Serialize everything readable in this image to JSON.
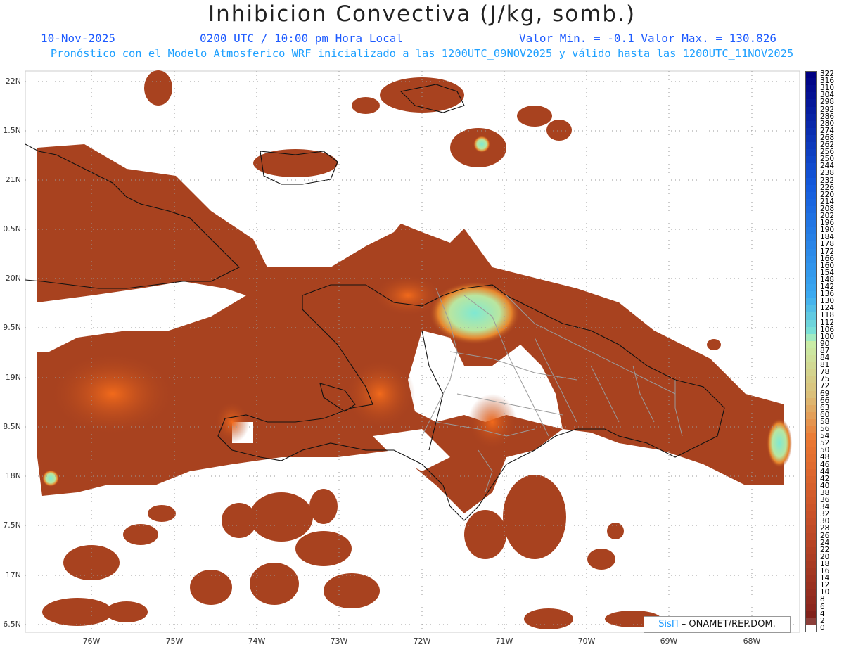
{
  "title": "Inhibicion Convectiva (J/kg, somb.)",
  "date": "10-Nov-2025",
  "time": "0200 UTC / 10:00 pm Hora Local",
  "minmax": "Valor Min. = -0.1  Valor Max. = 130.826",
  "model_line": "Pronóstico con el Modelo Atmosferico WRF inicializado a las 1200UTC_09NOV2025 y válido hasta las  1200UTC_11NOV2025",
  "lat_labels": [
    "22N",
    "1.5N",
    "21N",
    "0.5N",
    "20N",
    "9.5N",
    "19N",
    "8.5N",
    "18N",
    "7.5N",
    "17N",
    "6.5N"
  ],
  "lon_labels": [
    "76W",
    "75W",
    "74W",
    "73W",
    "72W",
    "71W",
    "70W",
    "69W",
    "68W"
  ],
  "legend_values": [
    "322",
    "316",
    "310",
    "304",
    "298",
    "292",
    "286",
    "280",
    "274",
    "268",
    "262",
    "256",
    "250",
    "244",
    "238",
    "232",
    "226",
    "220",
    "214",
    "208",
    "202",
    "196",
    "190",
    "184",
    "178",
    "172",
    "166",
    "160",
    "154",
    "148",
    "142",
    "136",
    "130",
    "124",
    "118",
    "112",
    "106",
    "100",
    "90",
    "87",
    "84",
    "81",
    "78",
    "75",
    "72",
    "69",
    "66",
    "63",
    "60",
    "58",
    "56",
    "54",
    "52",
    "50",
    "48",
    "46",
    "44",
    "42",
    "40",
    "38",
    "36",
    "34",
    "32",
    "30",
    "28",
    "26",
    "24",
    "22",
    "20",
    "18",
    "16",
    "14",
    "12",
    "10",
    "8",
    "6",
    "4",
    "2",
    "0"
  ],
  "credit": {
    "sis": "SisΠ",
    "rest": " – ONAMET/REP.DOM."
  },
  "colors": {
    "field": "#a8421f",
    "field_hot": "#e8651f",
    "field_cool": "#8ee6c4",
    "border": "#111111",
    "province": "#9a9a9a"
  }
}
